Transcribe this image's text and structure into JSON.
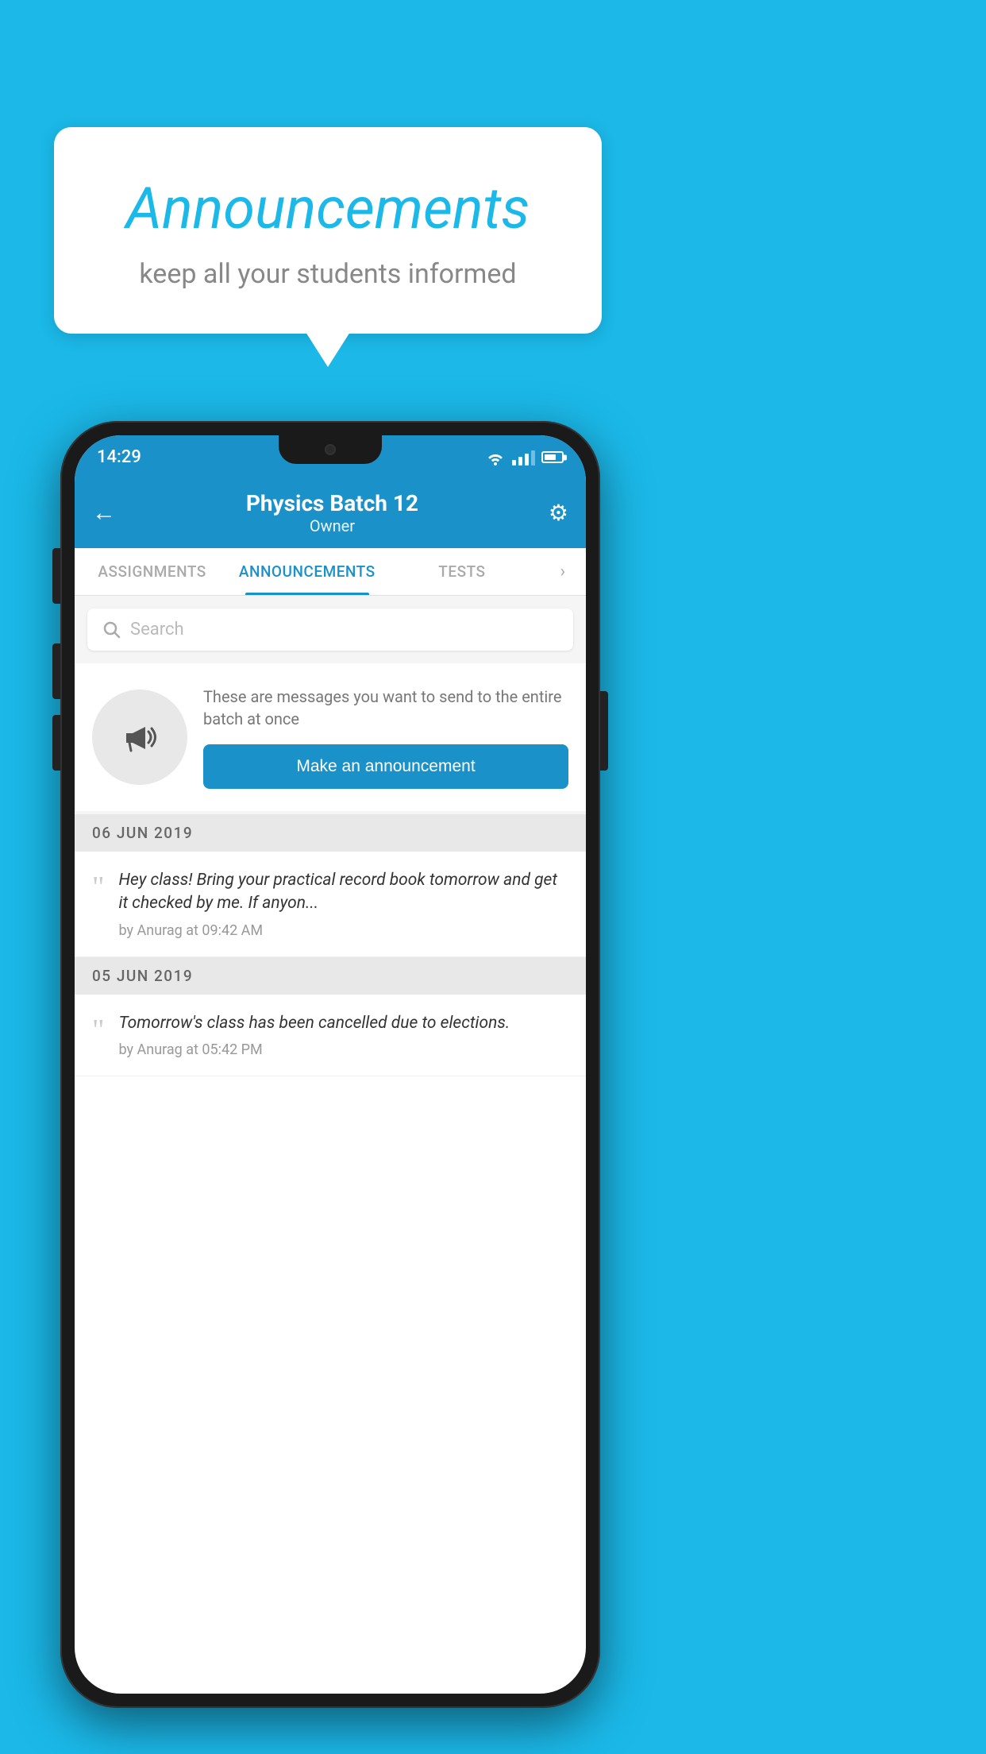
{
  "background_color": "#1bb8e8",
  "speech_bubble": {
    "title": "Announcements",
    "subtitle": "keep all your students informed"
  },
  "phone": {
    "status_bar": {
      "time": "14:29"
    },
    "header": {
      "title": "Physics Batch 12",
      "subtitle": "Owner",
      "back_label": "←",
      "gear_label": "⚙"
    },
    "tabs": [
      {
        "label": "ASSIGNMENTS",
        "active": false
      },
      {
        "label": "ANNOUNCEMENTS",
        "active": true
      },
      {
        "label": "TESTS",
        "active": false
      }
    ],
    "search": {
      "placeholder": "Search"
    },
    "promo": {
      "text": "These are messages you want to send to the entire batch at once",
      "button_label": "Make an announcement"
    },
    "announcements": [
      {
        "date": "06  JUN  2019",
        "items": [
          {
            "text": "Hey class! Bring your practical record book tomorrow and get it checked by me. If anyon...",
            "meta": "by Anurag at 09:42 AM"
          }
        ]
      },
      {
        "date": "05  JUN  2019",
        "items": [
          {
            "text": "Tomorrow's class has been cancelled due to elections.",
            "meta": "by Anurag at 05:42 PM"
          }
        ]
      }
    ]
  }
}
